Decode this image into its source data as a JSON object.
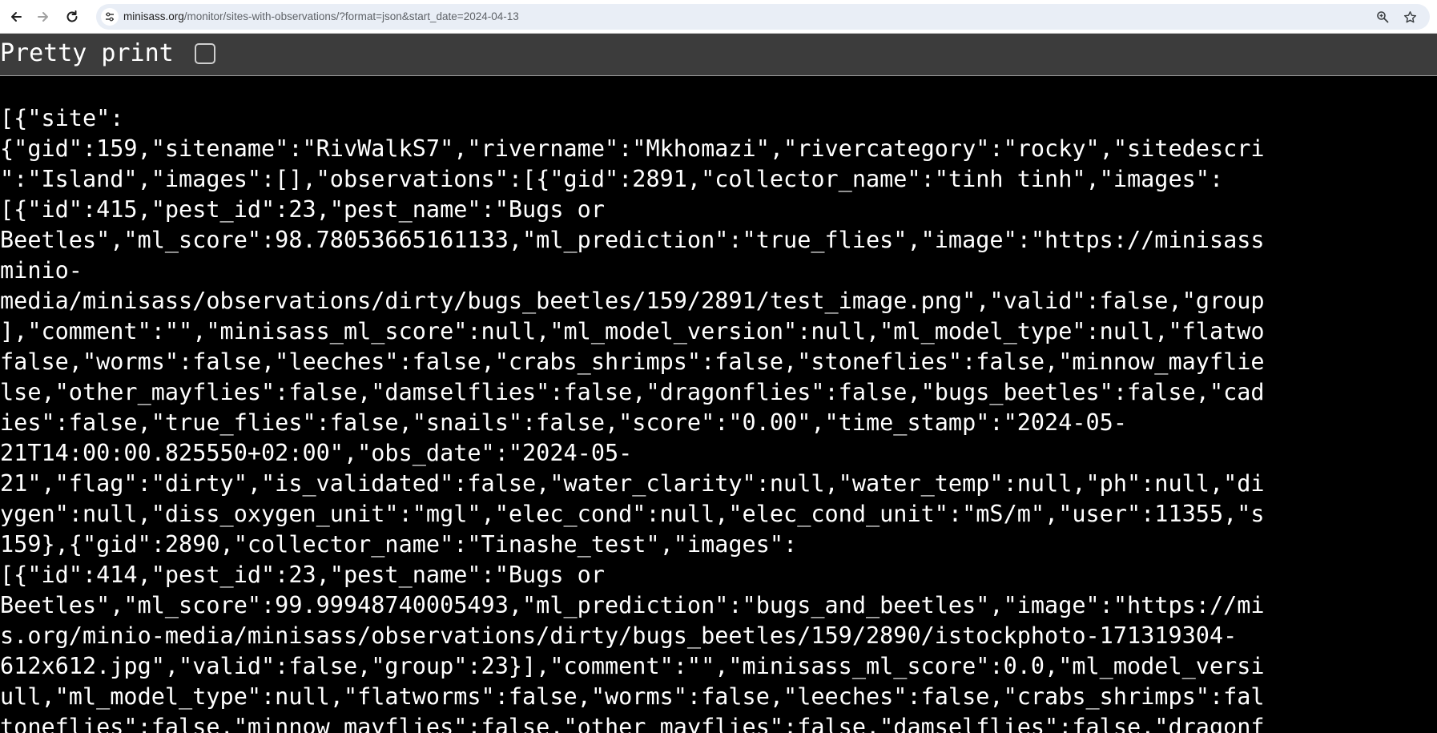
{
  "browser": {
    "url_host": "minisass.org",
    "url_rest": "/monitor/sites-with-observations/?format=json&start_date=2024-04-13"
  },
  "toolbar": {
    "pretty_print_label": "Pretty print",
    "pretty_print_checked": false
  },
  "json_lines": [
    "[{\"site\":",
    "{\"gid\":159,\"sitename\":\"RivWalkS7\",\"rivername\":\"Mkhomazi\",\"rivercategory\":\"rocky\",\"sitedescri",
    "\":\"Island\",\"images\":[],\"observations\":[{\"gid\":2891,\"collector_name\":\"tinh tinh\",\"images\":",
    "[{\"id\":415,\"pest_id\":23,\"pest_name\":\"Bugs or",
    "Beetles\",\"ml_score\":98.78053665161133,\"ml_prediction\":\"true_flies\",\"image\":\"https://minisass",
    "minio-",
    "media/minisass/observations/dirty/bugs_beetles/159/2891/test_image.png\",\"valid\":false,\"group",
    "],\"comment\":\"\",\"minisass_ml_score\":null,\"ml_model_version\":null,\"ml_model_type\":null,\"flatwo",
    "false,\"worms\":false,\"leeches\":false,\"crabs_shrimps\":false,\"stoneflies\":false,\"minnow_mayflie",
    "lse,\"other_mayflies\":false,\"damselflies\":false,\"dragonflies\":false,\"bugs_beetles\":false,\"cad",
    "ies\":false,\"true_flies\":false,\"snails\":false,\"score\":\"0.00\",\"time_stamp\":\"2024-05-",
    "21T14:00:00.825550+02:00\",\"obs_date\":\"2024-05-",
    "21\",\"flag\":\"dirty\",\"is_validated\":false,\"water_clarity\":null,\"water_temp\":null,\"ph\":null,\"di",
    "ygen\":null,\"diss_oxygen_unit\":\"mgl\",\"elec_cond\":null,\"elec_cond_unit\":\"mS/m\",\"user\":11355,\"s",
    "159},{\"gid\":2890,\"collector_name\":\"Tinashe_test\",\"images\":",
    "[{\"id\":414,\"pest_id\":23,\"pest_name\":\"Bugs or",
    "Beetles\",\"ml_score\":99.99948740005493,\"ml_prediction\":\"bugs_and_beetles\",\"image\":\"https://mi",
    "s.org/minio-media/minisass/observations/dirty/bugs_beetles/159/2890/istockphoto-171319304-",
    "612x612.jpg\",\"valid\":false,\"group\":23}],\"comment\":\"\",\"minisass_ml_score\":0.0,\"ml_model_versi",
    "ull,\"ml_model_type\":null,\"flatworms\":false,\"worms\":false,\"leeches\":false,\"crabs_shrimps\":fal",
    "toneflies\":false,\"minnow_mayflies\":false,\"other_mayflies\":false,\"damselflies\":false,\"dragonf"
  ]
}
